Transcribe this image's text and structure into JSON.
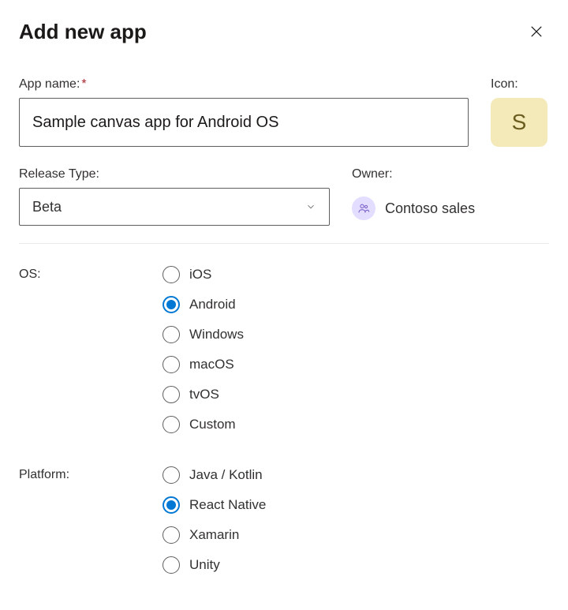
{
  "header": {
    "title": "Add new app"
  },
  "appName": {
    "label": "App name:",
    "value": "Sample canvas app for Android OS"
  },
  "icon": {
    "label": "Icon:",
    "letter": "S"
  },
  "releaseType": {
    "label": "Release Type:",
    "value": "Beta"
  },
  "owner": {
    "label": "Owner:",
    "name": "Contoso sales"
  },
  "os": {
    "label": "OS:",
    "selected": "Android",
    "options": [
      "iOS",
      "Android",
      "Windows",
      "macOS",
      "tvOS",
      "Custom"
    ]
  },
  "platform": {
    "label": "Platform:",
    "selected": "React Native",
    "options": [
      "Java / Kotlin",
      "React Native",
      "Xamarin",
      "Unity"
    ]
  }
}
